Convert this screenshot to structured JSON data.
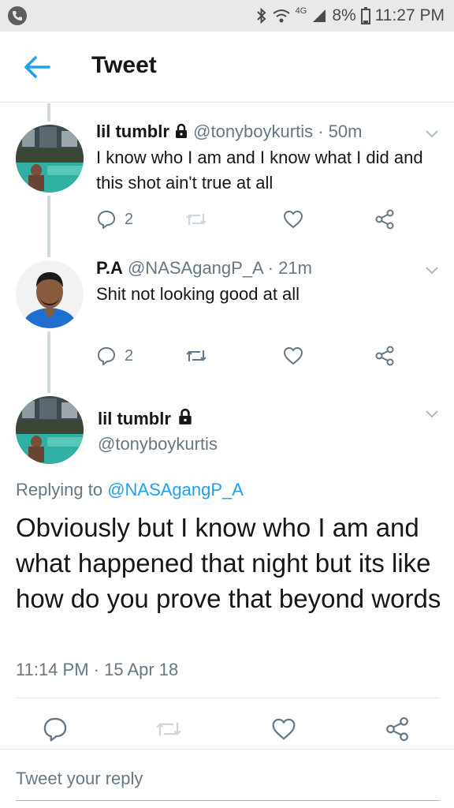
{
  "status_bar": {
    "battery": "8%",
    "time": "11:27 PM",
    "network": "4G",
    "icons": [
      "phone-icon",
      "bluetooth-icon",
      "wifi-icon",
      "signal-icon",
      "battery-icon"
    ]
  },
  "header": {
    "title": "Tweet",
    "back_icon": "back-arrow-icon"
  },
  "thread": [
    {
      "name": "lil tumblr",
      "handle": "@tonyboykurtis",
      "sep": " · ",
      "time": "50m",
      "text": "I know who I am and I know what I did and this shot ain't true at all",
      "reply_count": "2"
    },
    {
      "name": "P.A",
      "handle": "@NASAgangP_A",
      "sep": " · ",
      "time": "21m",
      "text": "Shit not looking good at all",
      "reply_count": "2"
    }
  ],
  "focus_tweet": {
    "name": "lil tumblr",
    "handle": "@tonyboykurtis",
    "replying_prefix": "Replying to ",
    "replying_to": "@NASAgangP_A",
    "text": "Obviously but I know who I am and what happened that night but its like how do you prove that beyond words",
    "timestamp": "11:14 PM · 15 Apr 18"
  },
  "reply_box": {
    "placeholder": "Tweet your reply"
  },
  "colors": {
    "accent": "#1da1f2",
    "muted": "#657786",
    "text": "#14171a",
    "thread_line": "#cfd9de"
  }
}
